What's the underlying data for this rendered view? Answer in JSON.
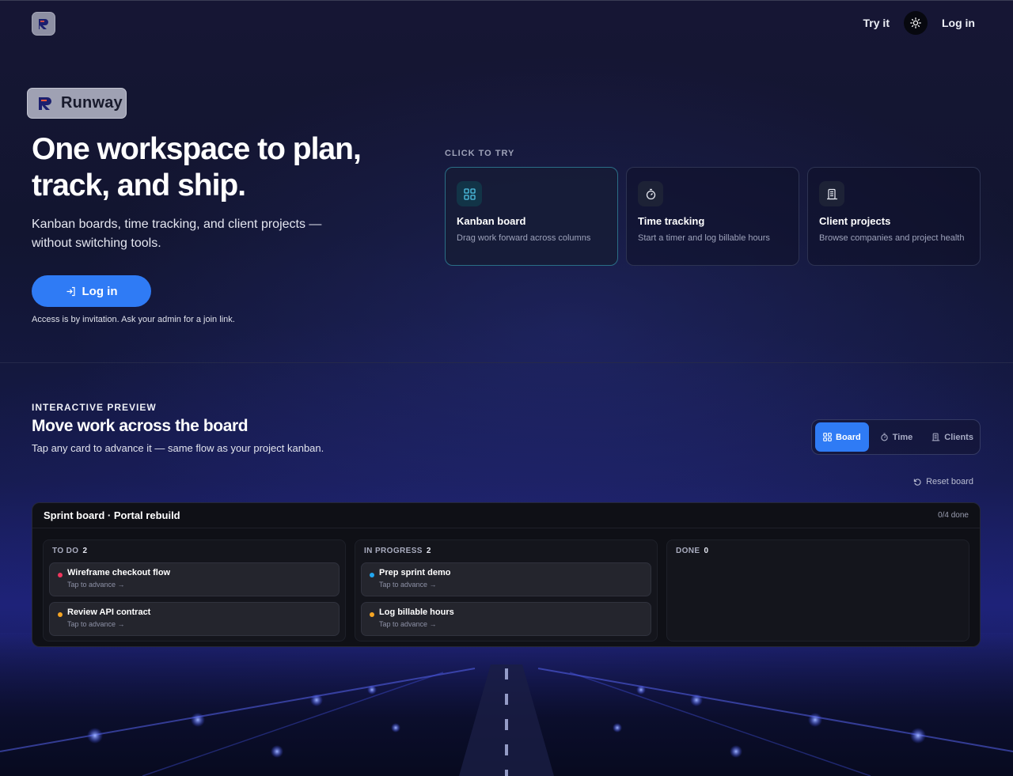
{
  "nav": {
    "try_label": "Try it",
    "login_label": "Log in",
    "theme_icon": "sun-icon"
  },
  "hero": {
    "brand_name": "Runway",
    "title": "One workspace to plan, track, and ship.",
    "subtitle": "Kanban boards, time tracking, and client projects — without switching tools.",
    "login_button": "Log in",
    "access_note": "Access is by invitation. Ask your admin for a join link."
  },
  "features": {
    "label": "CLICK TO TRY",
    "items": [
      {
        "title": "Kanban board",
        "desc": "Drag work forward across columns",
        "icon": "grid-icon",
        "active": true
      },
      {
        "title": "Time tracking",
        "desc": "Start a timer and log billable hours",
        "icon": "stopwatch-icon",
        "active": false
      },
      {
        "title": "Client projects",
        "desc": "Browse companies and project health",
        "icon": "building-icon",
        "active": false
      }
    ]
  },
  "preview": {
    "eyebrow": "INTERACTIVE PREVIEW",
    "title": "Move work across the board",
    "subtitle": "Tap any card to advance it — same flow as your project kanban.",
    "tabs": [
      {
        "label": "Board",
        "icon": "grid-icon",
        "active": true
      },
      {
        "label": "Time",
        "icon": "stopwatch-icon",
        "active": false
      },
      {
        "label": "Clients",
        "icon": "building-icon",
        "active": false
      }
    ],
    "reset_label": "Reset board"
  },
  "board": {
    "title": "Sprint board · Portal rebuild",
    "progress": "0/4 done",
    "columns": [
      {
        "name": "TO DO",
        "count": "2",
        "tasks": [
          {
            "title": "Wireframe checkout flow",
            "hint": "Tap to advance →",
            "color": "#f0365d"
          },
          {
            "title": "Review API contract",
            "hint": "Tap to advance →",
            "color": "#f5a524"
          }
        ]
      },
      {
        "name": "IN PROGRESS",
        "count": "2",
        "tasks": [
          {
            "title": "Prep sprint demo",
            "hint": "Tap to advance →",
            "color": "#22a6f0"
          },
          {
            "title": "Log billable hours",
            "hint": "Tap to advance →",
            "color": "#f5a524"
          }
        ]
      },
      {
        "name": "DONE",
        "count": "0",
        "tasks": []
      }
    ]
  },
  "colors": {
    "accent": "#2f7bf5",
    "active_card_border": "#2a6e86"
  }
}
